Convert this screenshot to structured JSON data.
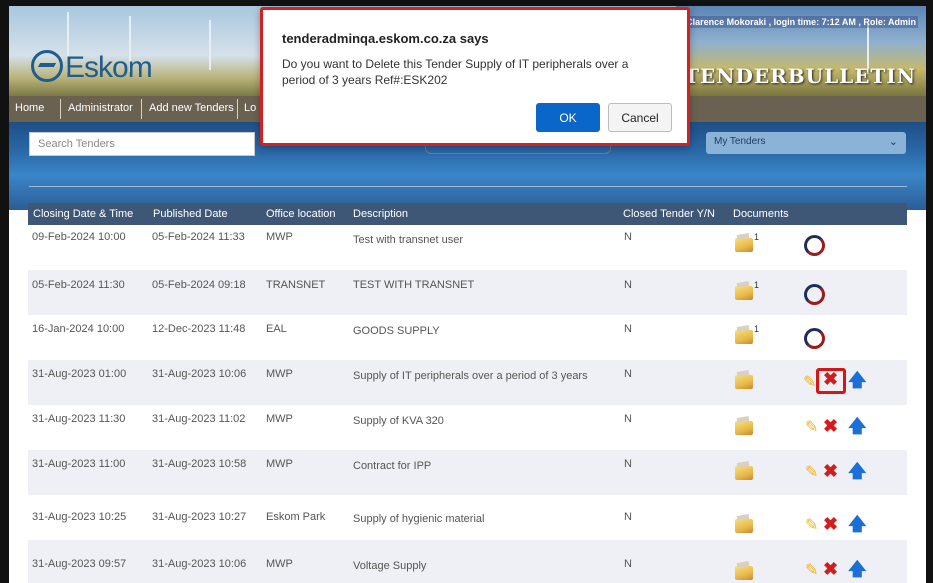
{
  "header": {
    "logo_text": "Eskom",
    "brand": "TENDERBULLETIN",
    "user_info": "Clarence Mokoraki , login time: 7:12 AM , Role: Admin"
  },
  "nav": {
    "items": [
      "Home",
      "Administrator",
      "Add new Tenders",
      "Lo"
    ]
  },
  "search": {
    "placeholder": "Search Tenders"
  },
  "filter": {
    "selected": "My Tenders"
  },
  "table": {
    "headers": [
      "Closing Date & Time",
      "Published Date",
      "Office location",
      "Description",
      "Closed Tender Y/N",
      "Documents"
    ],
    "rows": [
      {
        "closing": "09-Feb-2024 10:00",
        "published": "05-Feb-2024 11:33",
        "office": "MWP",
        "description": "Test with transnet user",
        "closed": "N",
        "doc_count": "1",
        "actions": "status"
      },
      {
        "closing": "05-Feb-2024 11:30",
        "published": "05-Feb-2024 09:18",
        "office": "TRANSNET",
        "description": "TEST WITH TRANSNET",
        "closed": "N",
        "doc_count": "1",
        "actions": "status"
      },
      {
        "closing": "16-Jan-2024 10:00",
        "published": "12-Dec-2023 11:48",
        "office": "EAL",
        "description": "GOODS SUPPLY",
        "closed": "N",
        "doc_count": "1",
        "actions": "status"
      },
      {
        "closing": "31-Aug-2023 01:00",
        "published": "31-Aug-2023 10:06",
        "office": "MWP",
        "description": "Supply of IT peripherals over a period of 3 years",
        "closed": "N",
        "doc_count": "",
        "actions": "edit"
      },
      {
        "closing": "31-Aug-2023 11:30",
        "published": "31-Aug-2023 11:02",
        "office": "MWP",
        "description": "Supply of KVA 320",
        "closed": "N",
        "doc_count": "",
        "actions": "edit"
      },
      {
        "closing": "31-Aug-2023 11:00",
        "published": "31-Aug-2023 10:58",
        "office": "MWP",
        "description": "Contract for IPP",
        "closed": "N",
        "doc_count": "",
        "actions": "edit"
      },
      {
        "closing": "31-Aug-2023 10:25",
        "published": "31-Aug-2023 10:27",
        "office": "Eskom Park",
        "description": "Supply of hygienic material",
        "closed": "N",
        "doc_count": "",
        "actions": "edit"
      },
      {
        "closing": "31-Aug-2023 09:57",
        "published": "31-Aug-2023 10:06",
        "office": "MWP",
        "description": "Voltage Supply",
        "closed": "N",
        "doc_count": "",
        "actions": "edit"
      }
    ]
  },
  "dialog": {
    "title": "tenderadminqa.eskom.co.za says",
    "message": "Do you want to Delete this Tender Supply of IT peripherals over a period of 3 years   Ref#:ESK202",
    "ok_label": "OK",
    "cancel_label": "Cancel"
  },
  "icons": {
    "folder": "folder-icon",
    "status": "status-ring-icon",
    "edit": "pencil-icon",
    "delete": "delete-x-icon",
    "publish": "up-arrow-icon"
  },
  "colors": {
    "nav_bg": "#6b6150",
    "table_header": "#3e5777",
    "ok_button": "#0a67c9",
    "highlight": "#d42020"
  }
}
